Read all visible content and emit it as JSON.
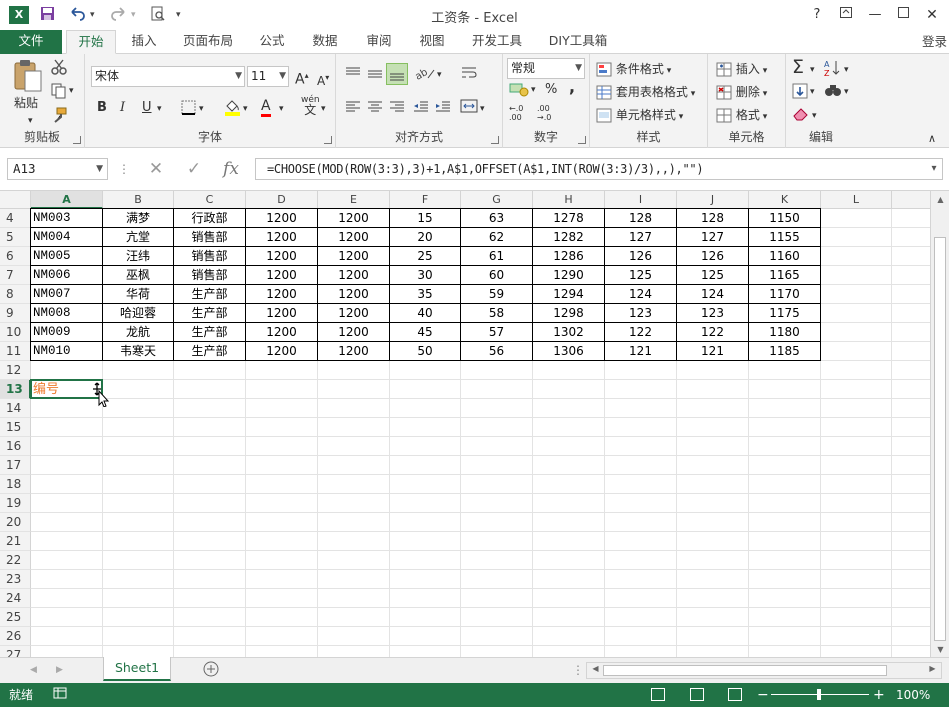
{
  "titlebar": {
    "app_icon": "X",
    "title": "工资条 - Excel",
    "help": "?",
    "qa_save_icon": "save-icon",
    "qa_undo_icon": "undo-icon",
    "qa_redo_icon": "redo-icon",
    "qa_preview_icon": "print-preview-icon"
  },
  "tabs": {
    "file": "文件",
    "home": "开始",
    "insert": "插入",
    "layout": "页面布局",
    "formulas": "公式",
    "data": "数据",
    "review": "审阅",
    "view": "视图",
    "developer": "开发工具",
    "diy": "DIY工具箱",
    "login": "登录"
  },
  "ribbon": {
    "clipboard": {
      "label": "剪贴板",
      "paste": "粘贴"
    },
    "font": {
      "label": "字体",
      "name": "宋体",
      "size": "11",
      "bold": "B",
      "italic": "I",
      "underline": "U",
      "wen": "wén\n文"
    },
    "align": {
      "label": "对齐方式"
    },
    "number": {
      "label": "数字",
      "format": "常规",
      "percent": "%",
      "comma": ","
    },
    "styles": {
      "label": "样式",
      "conditional": "条件格式",
      "table": "套用表格格式",
      "cell": "单元格样式"
    },
    "cells": {
      "label": "单元格",
      "insert": "插入",
      "delete": "删除",
      "format": "格式"
    },
    "editing": {
      "label": "编辑"
    }
  },
  "formula_bar": {
    "name_box": "A13",
    "formula": "=CHOOSE(MOD(ROW(3:3),3)+1,A$1,OFFSET(A$1,INT(ROW(3:3)/3),,),\"\")"
  },
  "columns": [
    "A",
    "B",
    "C",
    "D",
    "E",
    "F",
    "G",
    "H",
    "I",
    "J",
    "K",
    "L"
  ],
  "rows": [
    "4",
    "5",
    "6",
    "7",
    "8",
    "9",
    "10",
    "11",
    "12",
    "13",
    "14",
    "15",
    "16",
    "17",
    "18",
    "19",
    "20",
    "21",
    "22",
    "23",
    "24",
    "25",
    "26",
    "27"
  ],
  "table": [
    [
      "NM003",
      "满梦",
      "行政部",
      "1200",
      "1200",
      "15",
      "63",
      "1278",
      "128",
      "128",
      "1150"
    ],
    [
      "NM004",
      "亢堂",
      "销售部",
      "1200",
      "1200",
      "20",
      "62",
      "1282",
      "127",
      "127",
      "1155"
    ],
    [
      "NM005",
      "汪纬",
      "销售部",
      "1200",
      "1200",
      "25",
      "61",
      "1286",
      "126",
      "126",
      "1160"
    ],
    [
      "NM006",
      "巫枫",
      "销售部",
      "1200",
      "1200",
      "30",
      "60",
      "1290",
      "125",
      "125",
      "1165"
    ],
    [
      "NM007",
      "华荷",
      "生产部",
      "1200",
      "1200",
      "35",
      "59",
      "1294",
      "124",
      "124",
      "1170"
    ],
    [
      "NM008",
      "哈迎蓉",
      "生产部",
      "1200",
      "1200",
      "40",
      "58",
      "1298",
      "123",
      "123",
      "1175"
    ],
    [
      "NM009",
      "龙航",
      "生产部",
      "1200",
      "1200",
      "45",
      "57",
      "1302",
      "122",
      "122",
      "1180"
    ],
    [
      "NM010",
      "韦寒天",
      "生产部",
      "1200",
      "1200",
      "50",
      "56",
      "1306",
      "121",
      "121",
      "1185"
    ]
  ],
  "active_cell": {
    "value": "编号",
    "text_color": "#ED7D31"
  },
  "sheet_tab": "Sheet1",
  "status": {
    "ready": "就绪",
    "zoom": "100%"
  },
  "colors": {
    "accent": "#217346"
  }
}
